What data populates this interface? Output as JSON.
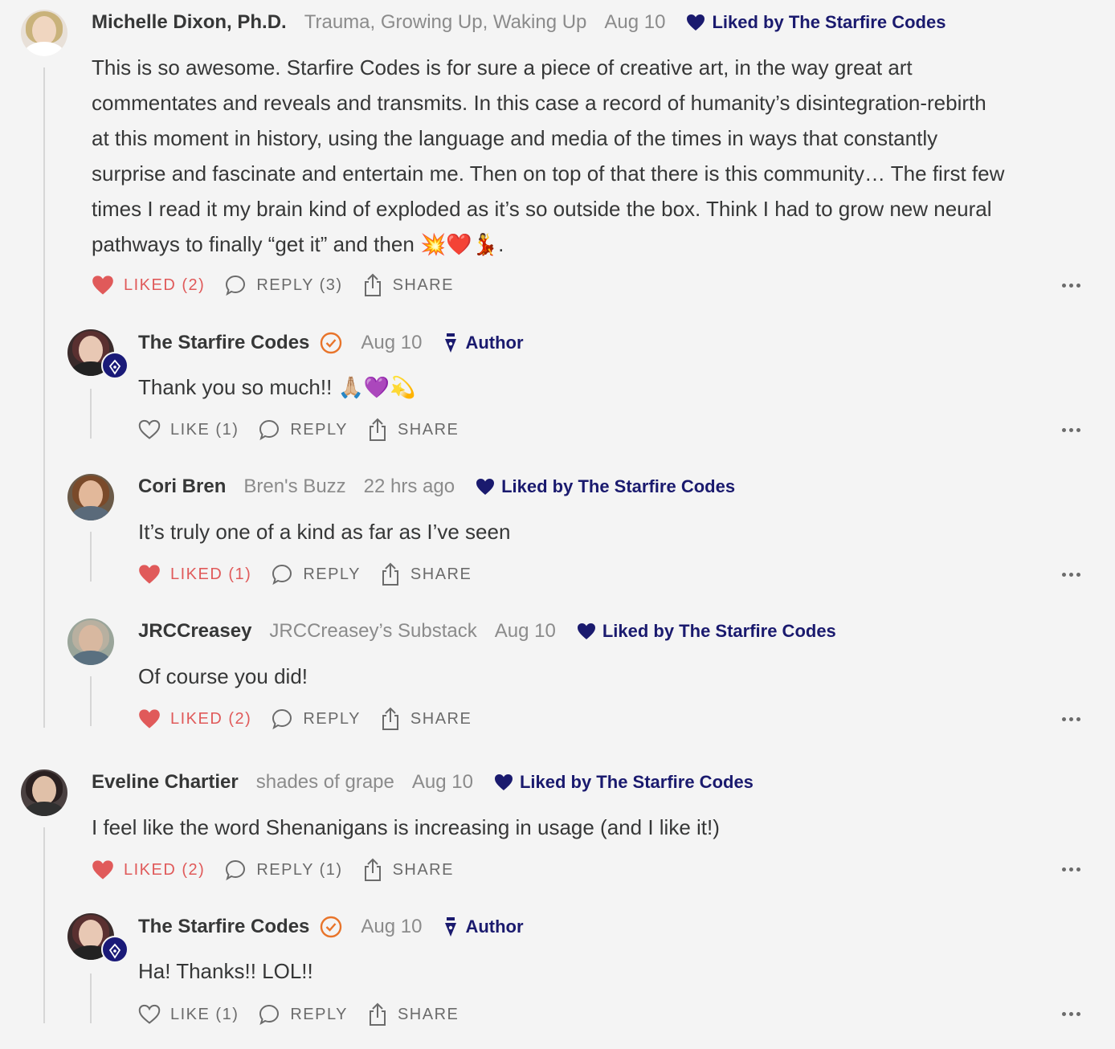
{
  "comments": [
    {
      "name": "Michelle Dixon, Ph.D.",
      "publication": "Trauma, Growing Up, Waking Up",
      "date": "Aug 10",
      "liked_by": "Liked by The Starfire Codes",
      "body_lines": [
        "This is so awesome. Starfire Codes is for sure a piece of creative art, in the way great art",
        "commentates and reveals and transmits. In this case a record of humanity’s disintegration-rebirth",
        "at this moment in history, using the language and media of the times in ways that constantly",
        "surprise and fascinate and entertain me. Then on top of that there is this community… The first few",
        "times I read it my brain kind of exploded as it’s so outside the box. Think I had to grow new neural",
        "pathways to finally “get it” and then 💥❤️💃."
      ],
      "like_label": "LIKED (2)",
      "reply_label": "REPLY (3)",
      "share_label": "SHARE"
    },
    {
      "name": "The Starfire Codes",
      "date": "Aug 10",
      "author_label": "Author",
      "body": "Thank you so much!! 🙏🏼💜💫",
      "like_label": "LIKE (1)",
      "reply_label": "REPLY",
      "share_label": "SHARE"
    },
    {
      "name": "Cori Bren",
      "publication": "Bren's Buzz",
      "date": "22 hrs ago",
      "liked_by": "Liked by The Starfire Codes",
      "body": "It’s truly one of a kind as far as I’ve seen",
      "like_label": "LIKED (1)",
      "reply_label": "REPLY",
      "share_label": "SHARE"
    },
    {
      "name": "JRCCreasey",
      "publication": "JRCCreasey’s Substack",
      "date": "Aug 10",
      "liked_by": "Liked by The Starfire Codes",
      "body": "Of course you did!",
      "like_label": "LIKED (2)",
      "reply_label": "REPLY",
      "share_label": "SHARE"
    },
    {
      "name": "Eveline Chartier",
      "publication": "shades of grape",
      "date": "Aug 10",
      "liked_by": "Liked by The Starfire Codes",
      "body": "I feel like the word Shenanigans is increasing in usage (and I like it!)",
      "like_label": "LIKED (2)",
      "reply_label": "REPLY (1)",
      "share_label": "SHARE"
    },
    {
      "name": "The Starfire Codes",
      "date": "Aug 10",
      "author_label": "Author",
      "body": "Ha! Thanks!! LOL!!",
      "like_label": "LIKE (1)",
      "reply_label": "REPLY",
      "share_label": "SHARE"
    }
  ],
  "colors": {
    "liked": "#e05a5a",
    "author_navy": "#1a1a6e",
    "muted": "#8b8b8b",
    "background": "#f4f4f4"
  },
  "icons": [
    "heart-icon",
    "comment-bubble-icon",
    "share-icon",
    "more-dots-icon",
    "verified-check-icon",
    "fountain-pen-icon"
  ]
}
